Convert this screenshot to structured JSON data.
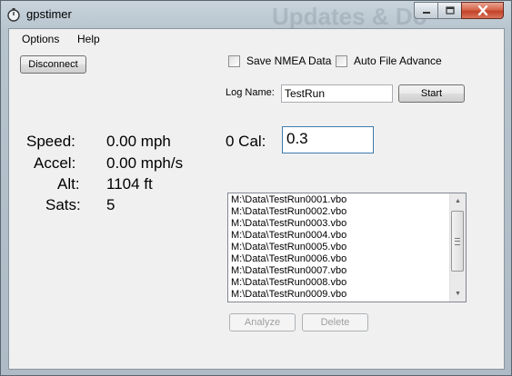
{
  "window": {
    "title": "gpstimer",
    "background_title": "Updates & Do",
    "icon": "stopwatch-icon",
    "controls": {
      "minimize": "minimize-icon",
      "maximize": "maximize-icon",
      "close": "close-icon"
    }
  },
  "menu": {
    "options": "Options",
    "help": "Help"
  },
  "toolbar": {
    "disconnect_label": "Disconnect"
  },
  "options": {
    "save_nmea_label": "Save NMEA Data",
    "save_nmea_checked": false,
    "auto_advance_label": "Auto File Advance",
    "auto_advance_checked": false
  },
  "log": {
    "label": "Log Name:",
    "value": "TestRun",
    "start_label": "Start"
  },
  "readouts": {
    "speed_label": "Speed:",
    "speed_value": "0.00 mph",
    "accel_label": "Accel:",
    "accel_value": "0.00 mph/s",
    "alt_label": "Alt:",
    "alt_value": "1104 ft",
    "sats_label": "Sats:",
    "sats_value": "5"
  },
  "calibration": {
    "label": "0 Cal:",
    "value": "0.3"
  },
  "files": [
    "M:\\Data\\TestRun0001.vbo",
    "M:\\Data\\TestRun0002.vbo",
    "M:\\Data\\TestRun0003.vbo",
    "M:\\Data\\TestRun0004.vbo",
    "M:\\Data\\TestRun0005.vbo",
    "M:\\Data\\TestRun0006.vbo",
    "M:\\Data\\TestRun0007.vbo",
    "M:\\Data\\TestRun0008.vbo",
    "M:\\Data\\TestRun0009.vbo"
  ],
  "actions": {
    "analyze_label": "Analyze",
    "delete_label": "Delete"
  },
  "colors": {
    "close_button": "#c2432a",
    "focus_border": "#3d7bad",
    "disabled_text": "#a0a0a0"
  }
}
